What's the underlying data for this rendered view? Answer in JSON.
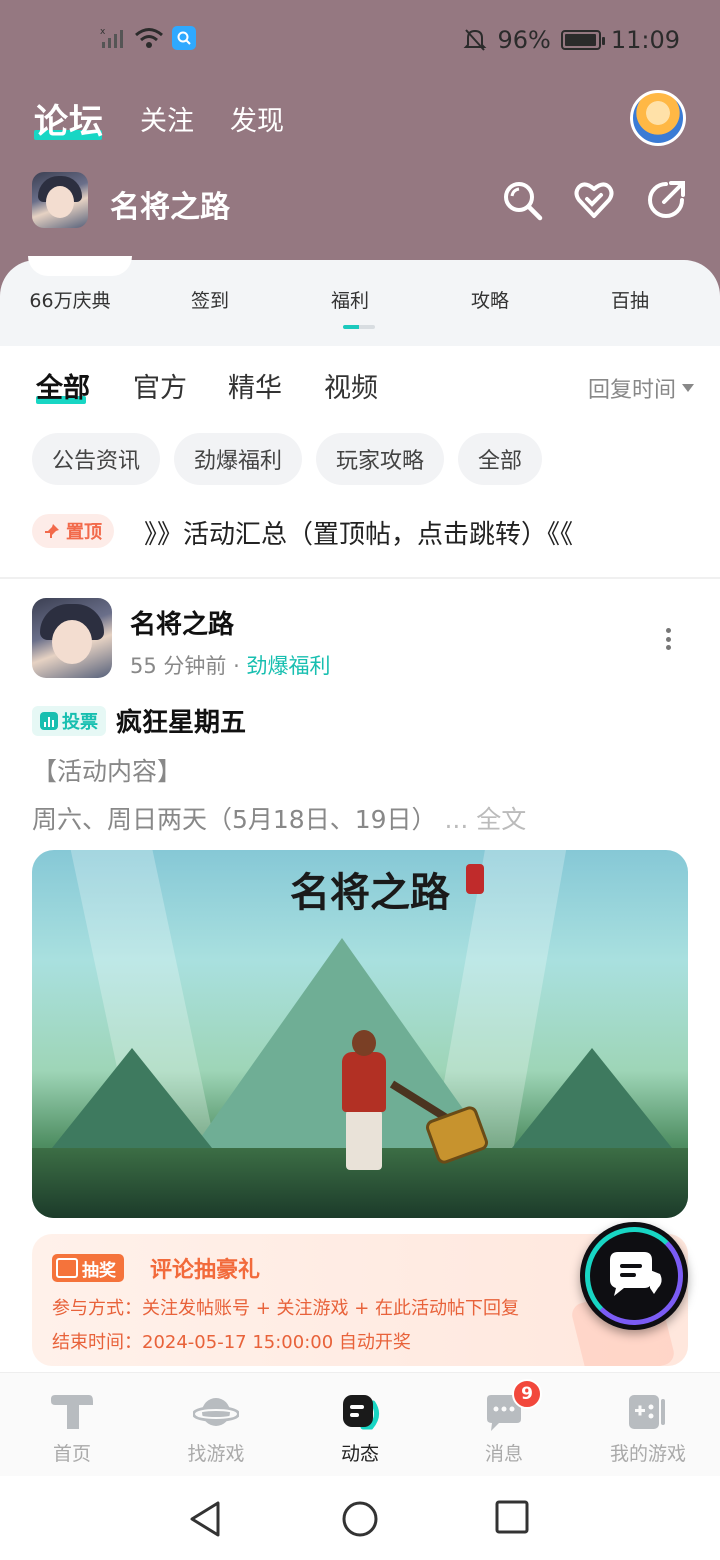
{
  "status_bar": {
    "battery": "96%",
    "time": "11:09",
    "battery_level": 0.96
  },
  "top_nav": {
    "logo": "论坛",
    "links": [
      "关注",
      "发现"
    ]
  },
  "forum": {
    "title": "名将之路"
  },
  "category_tabs": [
    {
      "label": "66万庆典"
    },
    {
      "label": "签到"
    },
    {
      "label": "福利"
    },
    {
      "label": "攻略"
    },
    {
      "label": "百抽"
    }
  ],
  "filters": {
    "tabs": [
      "全部",
      "官方",
      "精华",
      "视频"
    ],
    "sort": "回复时间"
  },
  "chips": [
    "公告资讯",
    "劲爆福利",
    "玩家攻略",
    "全部"
  ],
  "pinned": {
    "badge": "置顶",
    "text": "》》活动汇总（置顶帖，点击跳转）《《"
  },
  "post": {
    "author": "名将之路",
    "time": "55 分钟前",
    "separator": "·",
    "tag": "劲爆福利",
    "vote_badge": "投票",
    "title": "疯狂星期五",
    "line1": "【活动内容】",
    "line2": "周六、周日两天（5月18日、19日）",
    "more": "... 全文",
    "image_title": "名将之路"
  },
  "lottery": {
    "badge": "抽奖",
    "title": "评论抽豪礼",
    "line1": "参与方式：关注发帖账号 + 关注游戏 + 在此活动帖下回复",
    "line2": "结束时间：2024-05-17 15:00:00 自动开奖"
  },
  "bottom_nav": [
    {
      "label": "首页"
    },
    {
      "label": "找游戏"
    },
    {
      "label": "动态"
    },
    {
      "label": "消息",
      "badge": "9"
    },
    {
      "label": "我的游戏"
    }
  ],
  "colors": {
    "header_bg": "#957881",
    "accent": "#18d6c4",
    "orange": "#f26a3b"
  }
}
